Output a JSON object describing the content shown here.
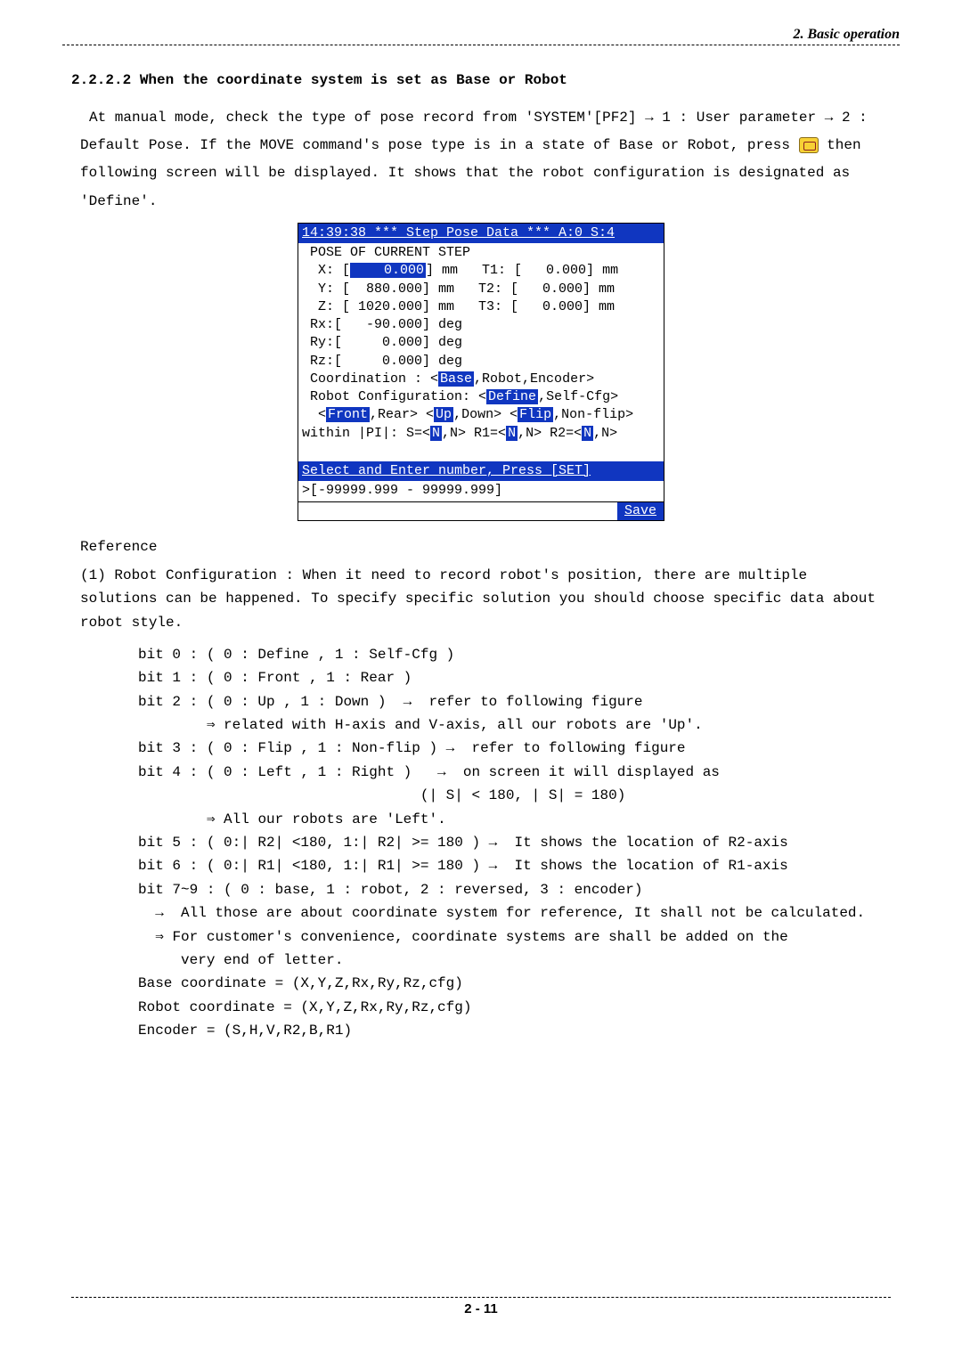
{
  "header": {
    "chapter": "2. Basic operation"
  },
  "section": {
    "title": "2.2.2.2 When the coordinate system is set as Base or Robot"
  },
  "intro": {
    "line1": "At manual mode, check the type of pose record from 'SYSTEM'[PF2] →  1 : User parameter →  2 :",
    "line2a": "Default Pose. If the MOVE command's pose type is in a state of Base or Robot, press ",
    "line2b": " then",
    "line3": "following screen will be displayed. It shows that the robot configuration is designated as",
    "line4": "'Define'."
  },
  "screen": {
    "title": "14:39:38 *** Step Pose Data *** A:0 S:4",
    "subtitle": " POSE OF CURRENT STEP",
    "rows": {
      "x": "  X: [    0.000] mm   T1: [   0.000] mm",
      "y": "  Y: [  880.000] mm   T2: [   0.000] mm",
      "z": "  Z: [ 1020.000] mm   T3: [   0.000] mm",
      "rx": " Rx:[   -90.000] deg",
      "ry": " Ry:[     0.000] deg",
      "rz": " Rz:[     0.000] deg"
    },
    "coord_pre": " Coordination : <",
    "coord_hi": "Base",
    "coord_post": ",Robot,Encoder>",
    "cfg_pre": " Robot Configuration: <",
    "cfg_hi": "Define",
    "cfg_post": ",Self-Cfg>",
    "fr": [
      "  <",
      "Front",
      ",Rear> <",
      "Up",
      ",Down> <",
      "Flip",
      ",Non-flip>"
    ],
    "pi": [
      "within |PI|: S=<",
      "N",
      ",N> R1=<",
      "N",
      ",N> R2=<",
      "N",
      ",N>"
    ],
    "prompt": "Select and Enter number, Press [SET]",
    "range": ">[-99999.999 - 99999.999]",
    "save": "Save"
  },
  "reference": {
    "label": "Reference"
  },
  "content": {
    "p1": " (1) Robot Configuration : When it need to record robot's position, there are multiple solutions can be happened. To specify specific solution you should choose specific data about robot style.",
    "bits": "bit 0 : ( 0 : Define , 1 : Self-Cfg )\nbit 1 : ( 0 : Front , 1 : Rear )\nbit 2 : ( 0 : Up , 1 : Down )  →  refer to following figure\n        ⇒ related with H-axis and V-axis, all our robots are 'Up'.\nbit 3 : ( 0 : Flip , 1 : Non-flip ) →  refer to following figure\nbit 4 : ( 0 : Left , 1 : Right )   →  on screen it will displayed as\n                                 (| S| < 180, | S| = 180)\n        ⇒ All our robots are 'Left'.\nbit 5 : ( 0:| R2| <180, 1:| R2| >= 180 ) →  It shows the location of R2-axis\nbit 6 : ( 0:| R1| <180, 1:| R1| >= 180 ) →  It shows the location of R1-axis\nbit 7~9 : ( 0 : base, 1 : robot, 2 : reversed, 3 : encoder)\n  →  All those are about coordinate system for reference, It shall not be calculated.\n  ⇒ For customer's convenience, coordinate systems are shall be added on the\n     very end of letter.\nBase coordinate = (X,Y,Z,Rx,Ry,Rz,cfg)\nRobot coordinate = (X,Y,Z,Rx,Ry,Rz,cfg)\nEncoder = (S,H,V,R2,B,R1)"
  },
  "footer": {
    "page": "2 - 11"
  }
}
